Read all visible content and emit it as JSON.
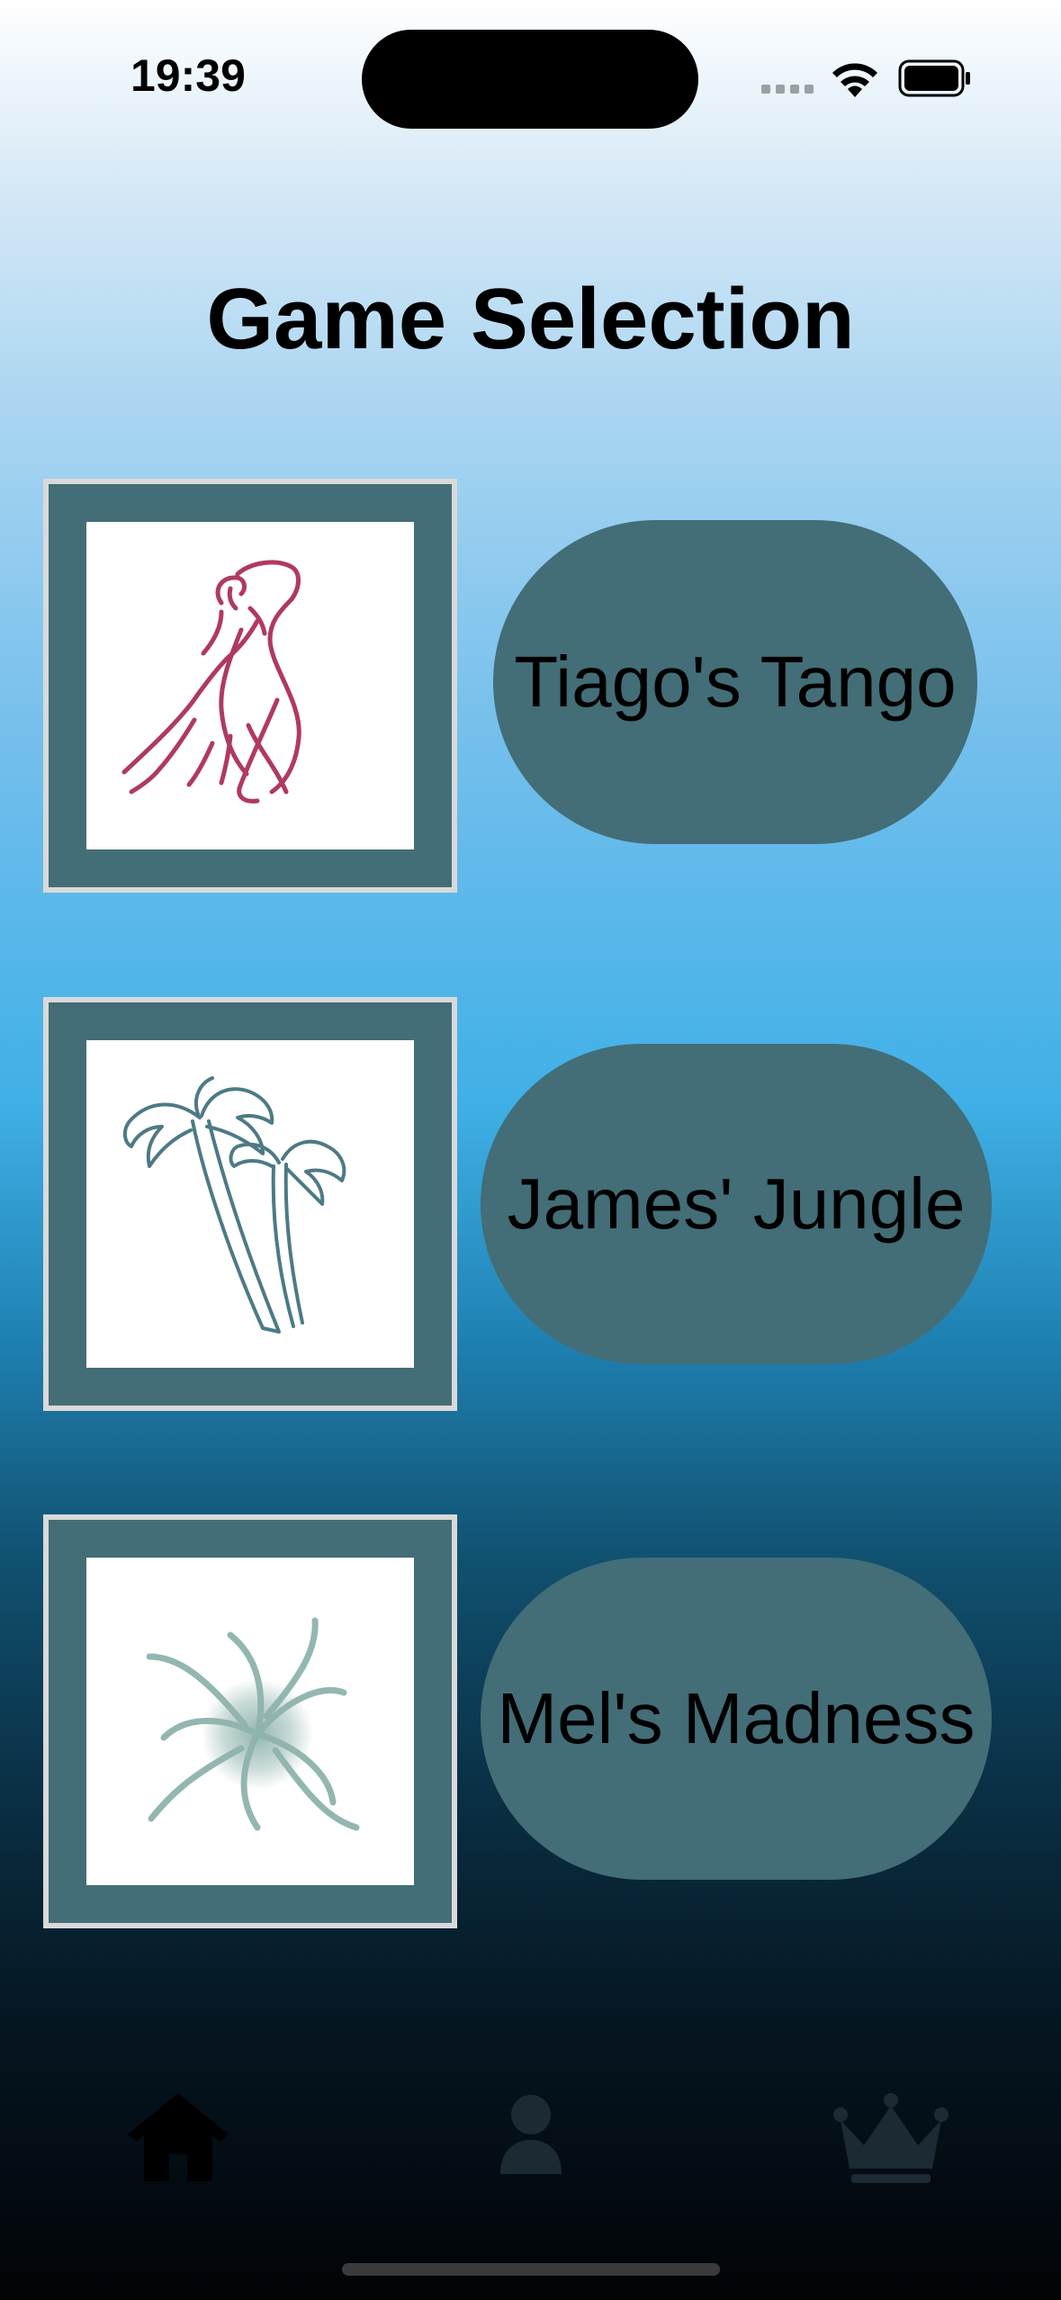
{
  "status_bar": {
    "time": "19:39"
  },
  "header": {
    "title": "Game Selection"
  },
  "games": [
    {
      "name": "Tiago's Tango",
      "image_icon": "tango-dancers-icon"
    },
    {
      "name": "James' Jungle",
      "image_icon": "palm-trees-icon"
    },
    {
      "name": "Mel's Madness",
      "image_icon": "spiral-vortex-icon"
    }
  ],
  "tab_bar": {
    "tabs": [
      {
        "icon": "house-icon",
        "selected": true
      },
      {
        "icon": "person-icon",
        "selected": false
      },
      {
        "icon": "crown-icon",
        "selected": false
      }
    ]
  },
  "colors": {
    "tile_background": "#436d77",
    "tile_border": "#d9d9d9",
    "button_background": "#436d77",
    "tango_stroke": "#b03a5f",
    "jungle_stroke": "#4d7a85",
    "vortex_stroke": "#8fb3ad",
    "tab_selected": "#000000",
    "tab_unselected": "#1c2a33"
  }
}
